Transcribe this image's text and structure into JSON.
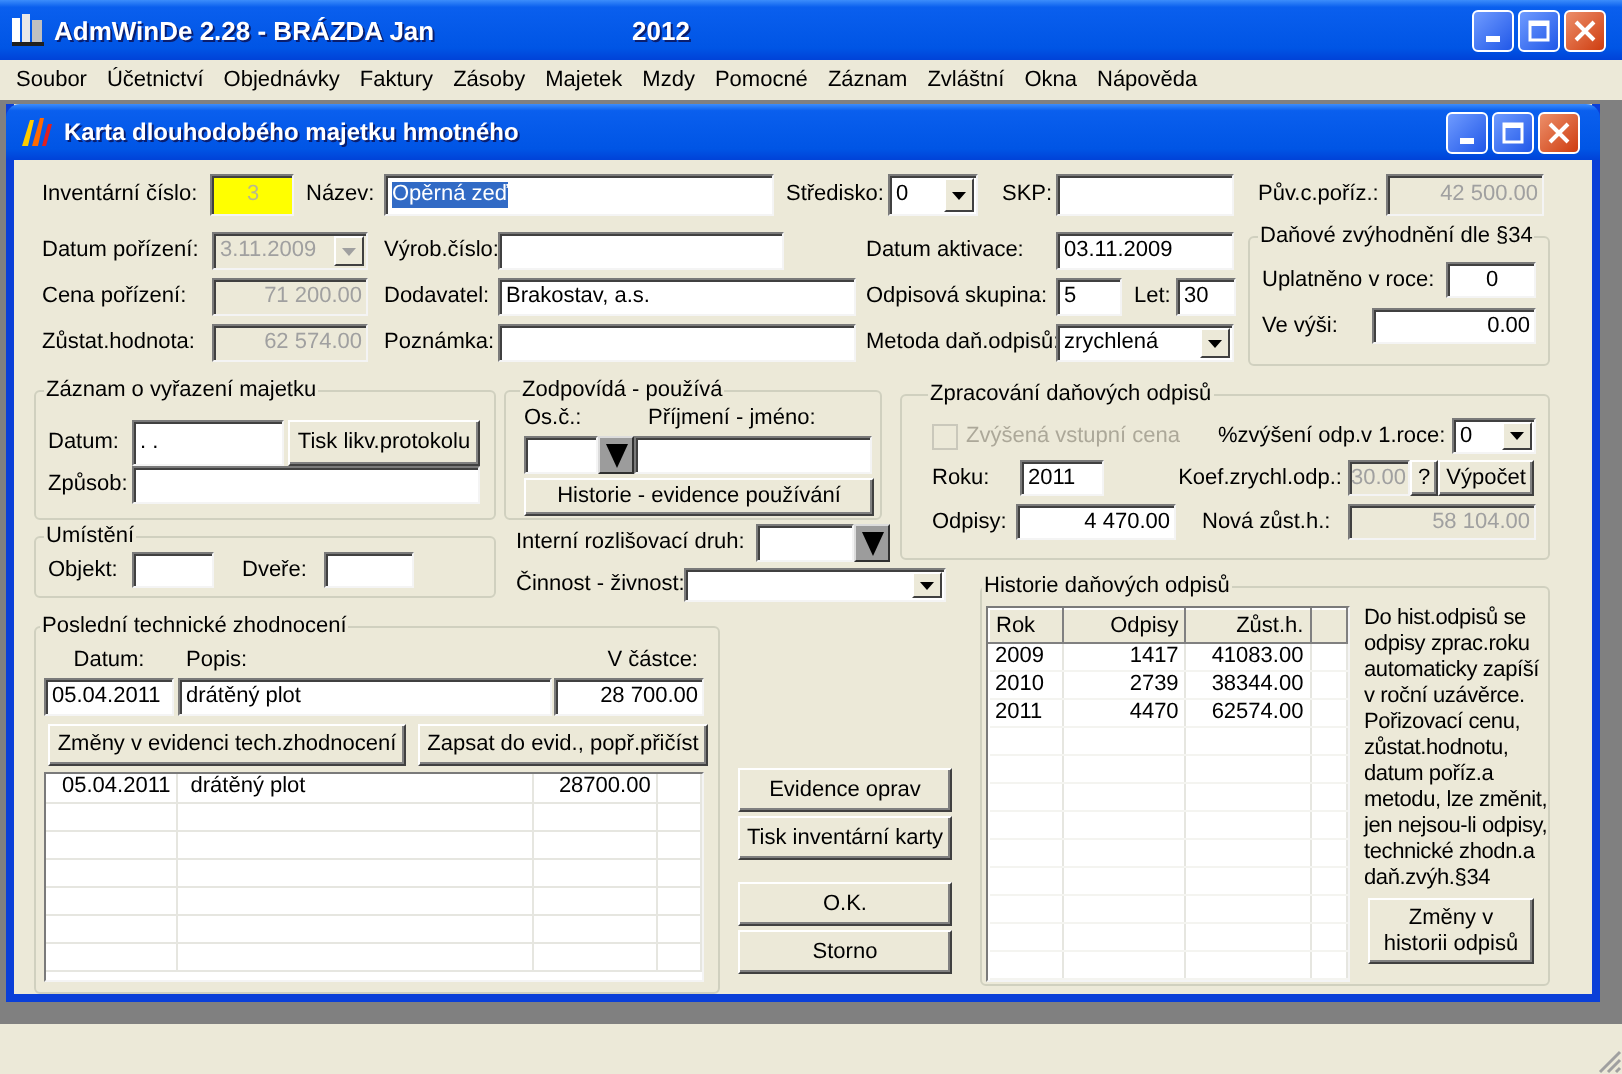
{
  "app": {
    "title": "AdmWinDe 2.28 - BRÁZDA Jan",
    "year": "2012"
  },
  "menu": [
    "Soubor",
    "Účetnictví",
    "Objednávky",
    "Faktury",
    "Zásoby",
    "Majetek",
    "Mzdy",
    "Pomocné",
    "Záznam",
    "Zvláštní",
    "Okna",
    "Nápověda"
  ],
  "dialog": {
    "title": "Karta dlouhodobého majetku hmotného",
    "inventory_no": {
      "label": "Inventární číslo:",
      "value": "3"
    },
    "name": {
      "label": "Název:",
      "value": "Opěrná zeď",
      "text_selected": true
    },
    "center": {
      "label": "Středisko:",
      "value": "0"
    },
    "skp": {
      "label": "SKP:"
    },
    "orig_price": {
      "label": "Pův.c.poříz.:",
      "value": "42 500.00",
      "disabled": true
    },
    "acq_date": {
      "label": "Datum pořízení:",
      "value": "3.11.2009",
      "disabled": true
    },
    "acq_price": {
      "label": "Cena pořízení:",
      "value": "71 200.00",
      "disabled": true
    },
    "residual": {
      "label": "Zůstat.hodnota:",
      "value": "62 574.00",
      "disabled": true
    },
    "serial": {
      "label": "Výrob.číslo:"
    },
    "supplier": {
      "label": "Dodavatel:",
      "value": "Brakostav, a.s."
    },
    "note": {
      "label": "Poznámka:"
    },
    "activation": {
      "label": "Datum aktivace:",
      "value": "03.11.2009"
    },
    "dep_group": {
      "label": "Odpisová skupina:",
      "value": "5"
    },
    "years": {
      "label": "Let:",
      "value": "30"
    },
    "method": {
      "label": "Metoda daň.odpisů:",
      "value": "zrychlená"
    },
    "tax_benefit": {
      "title": "Daňové zvýhodnění dle §34",
      "applied_year": {
        "label": "Uplatněno v roce:",
        "value": "0"
      },
      "amount": {
        "label": "Ve výši:",
        "value": "0.00"
      }
    },
    "disposal": {
      "title": "Záznam o vyřazení majetku",
      "date": {
        "label": "Datum:",
        "value": ". ."
      },
      "print_button": "Tisk likv.protokolu",
      "method": {
        "label": "Způsob:"
      }
    },
    "responsible": {
      "title": "Zodpovídá - používá",
      "id_label": "Os.č.:",
      "name_label": "Příjmení - jméno:",
      "history_button": "Historie - evidence používání"
    },
    "tax_processing": {
      "title": "Zpracování daňových odpisů",
      "increased_price": {
        "label": "Zvýšená vstupní cena",
        "checked": false,
        "disabled": true
      },
      "increase_pct": {
        "label": "%zvýšení odp.v 1.roce:",
        "value": "0"
      },
      "year": {
        "label": "Roku:",
        "value": "2011"
      },
      "coef": {
        "label": "Koef.zrychl.odp.:",
        "value": "30.00",
        "disabled": true
      },
      "help_button": "?",
      "calc_button": "Výpočet",
      "depreciation": {
        "label": "Odpisy:",
        "value": "4 470.00"
      },
      "new_residual": {
        "label": "Nová zůst.h.:",
        "value": "58 104.00",
        "disabled": true
      }
    },
    "location": {
      "title": "Umístění",
      "building": {
        "label": "Objekt:"
      },
      "door": {
        "label": "Dveře:"
      }
    },
    "internal_type": {
      "label": "Interní rozlišovací druh:"
    },
    "activity": {
      "label": "Činnost - živnost:"
    },
    "tech_improvement": {
      "title": "Poslední technické zhodnocení",
      "date": {
        "label": "Datum:",
        "value": "05.04.2011"
      },
      "desc": {
        "label": "Popis:",
        "value": "drátěný plot"
      },
      "amount": {
        "label": "V částce:",
        "value": "28 700.00"
      },
      "buttons": [
        "Změny v evidenci tech.zhodnocení",
        "Zapsat do evid., popř.přičíst"
      ],
      "rows": [
        [
          "05.04.2011",
          "drátěný plot",
          "28700.00"
        ]
      ]
    },
    "side_buttons": [
      "Evidence oprav",
      "Tisk inventární karty",
      "O.K.",
      "Storno"
    ],
    "tax_history": {
      "title": "Historie daňových odpisů",
      "columns": [
        "Rok",
        "Odpisy",
        "Zůst.h."
      ],
      "rows": [
        [
          "2009",
          "1417",
          "41083.00"
        ],
        [
          "2010",
          "2739",
          "38344.00"
        ],
        [
          "2011",
          "4470",
          "62574.00"
        ]
      ],
      "note": "Do hist.odpisů se odpisy zprac.roku automaticky zapíší v roční uzávěrce. Pořizovací cenu, zůstat.hodnotu, datum poříz.a metodu, lze změnit, jen nejsou-li odpisy, technické zhodn.a daň.zvýh.§34",
      "button": "Změny v historii odpisů"
    }
  }
}
